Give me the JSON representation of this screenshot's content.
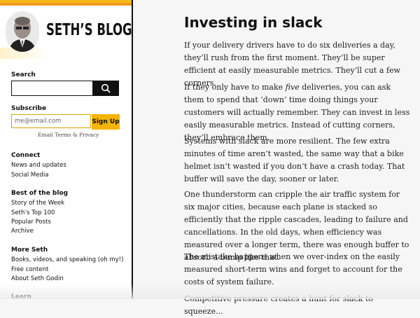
{
  "site": {
    "title": "SETH’S BLOG"
  },
  "search": {
    "heading": "Search",
    "value": ""
  },
  "subscribe": {
    "heading": "Subscribe",
    "placeholder": "me@email.com",
    "button": "Sign Up",
    "terms": "Email Terms & Privacy"
  },
  "sidebar": {
    "connect": {
      "heading": "Connect",
      "items": [
        "News and updates",
        "Social Media"
      ]
    },
    "best": {
      "heading": "Best of the blog",
      "items": [
        "Story of the Week",
        "Seth’s Top 100",
        "Popular Posts",
        "Archive"
      ]
    },
    "more": {
      "heading": "More Seth",
      "items": [
        "Books, videos, and speaking (oh my!)",
        "Free content",
        "About Seth Godin"
      ]
    },
    "learn": {
      "heading": "Learn"
    }
  },
  "post": {
    "title": "Investing in slack",
    "p1": "If your delivery drivers have to do six deliveries a day, they’ll rush from the first moment. They’ll be super efficient at easily measurable metrics. They’ll cut a few corners.",
    "p2_before": "If they only have to make ",
    "p2_em": "five",
    "p2_after": " deliveries, you can ask them to spend that ‘down’ time doing things your customers will actually remember. They can invest in less easily measurable metrics. Instead of cutting corners, they’ll embrace them.",
    "p3": "Systems with slack are more resilient. The few extra minutes of time aren’t wasted, the same way that a bike helmet isn’t wasted if you don’t have a crash today. That buffer will save the day, sooner or later.",
    "p4": "One thunderstorm can cripple the air traffic system for six major cities, because each plane is stacked so efficiently that the ripple cascades, leading to failure and cancellations. In the old days, when efficiency was measured over a longer term, there was enough buffer to absorb a bump like that.",
    "p5": "The mistake happens when we over-index on the easily measured short-term wins and forget to account for the costs of system failure.",
    "p6_partial": "Competitive pressure creates a hunt for slack to squeeze..."
  }
}
